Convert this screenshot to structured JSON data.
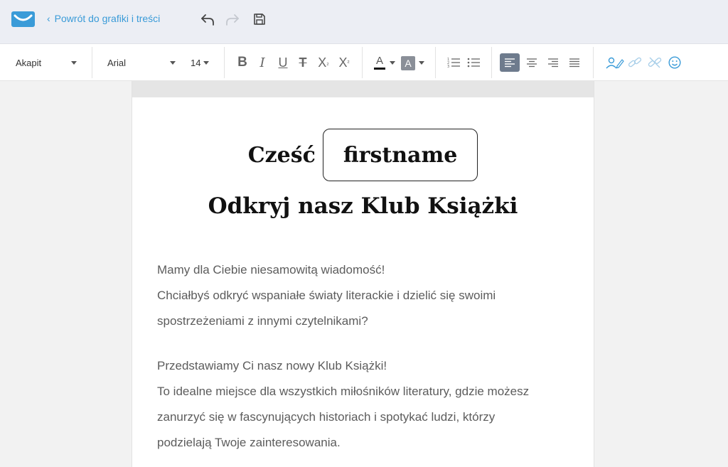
{
  "header": {
    "back_label": "Powrót do grafiki i treści",
    "icons": [
      "logo-envelope-icon",
      "undo-icon",
      "redo-icon",
      "save-icon"
    ]
  },
  "toolbar": {
    "paragraph_style": "Akapit",
    "font_family": "Arial",
    "font_size": "14",
    "text_color": "A",
    "highlight_color": "A",
    "buttons": [
      "bold",
      "italic",
      "underline",
      "strikethrough",
      "subscript",
      "superscript",
      "text-color",
      "highlight-color",
      "ordered-list",
      "unordered-list",
      "align-left",
      "align-center",
      "align-right",
      "justify",
      "personalize",
      "link",
      "unlink",
      "emoji"
    ]
  },
  "email": {
    "greeting": "Cześć",
    "token": "firstname",
    "headline": "Odkryj nasz Klub Książki",
    "para1": [
      "Mamy dla Ciebie niesamowitą wiadomość!",
      "Chciałbyś odkryć wspaniałe światy literackie i dzielić się swoimi",
      "spostrzeżeniami z innymi czytelnikami?"
    ],
    "para2": [
      "Przedstawiamy Ci nasz nowy Klub Książki!",
      "To idealne miejsce dla wszystkich miłośników literatury, gdzie możesz",
      "zanurzyć się w fascynujących historiach i spotykać ludzi, którzy",
      "podzielają Twoje zainteresowania."
    ]
  },
  "colors": {
    "accent": "#3a9bd8",
    "active_button": "#6e7b8d",
    "topbar_bg": "#eceef4",
    "canvas_bg": "#f2f2f2",
    "body_text": "#5c5c5c"
  }
}
